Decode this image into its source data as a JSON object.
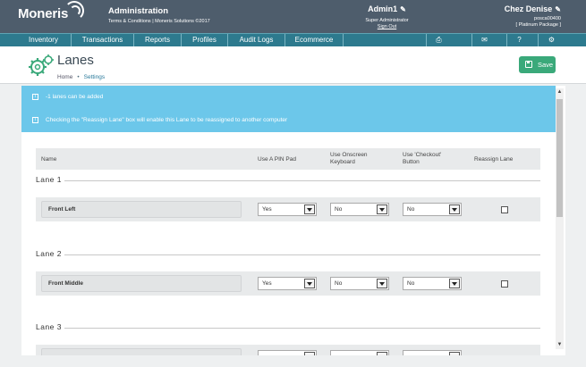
{
  "header": {
    "logo": "Moneris",
    "app_title": "Administration",
    "subtitle": "Terms & Conditions | Moneris Solutions ©2017",
    "user_name": "Admin1",
    "user_role": "Super Administrator",
    "sign_out": "Sign Out",
    "store_name": "Chez Denise",
    "store_id": "posca00400",
    "package": "[ Platinum Package ]"
  },
  "nav": {
    "items": [
      "Inventory",
      "Transactions",
      "Reports",
      "Profiles",
      "Audit Logs",
      "Ecommerce"
    ],
    "icons": [
      "printer-icon",
      "mail-icon",
      "help-icon",
      "settings-icon"
    ]
  },
  "page": {
    "title": "Lanes",
    "breadcrumb_home": "Home",
    "breadcrumb_sep": "•",
    "breadcrumb_current": "Settings",
    "save_label": "Save"
  },
  "banner": {
    "line1": "-1 lanes can be added",
    "line2": "Checking the \"Reassign Lane\" box will enable this Lane to be reassigned to another computer",
    "info_glyph": "i"
  },
  "table": {
    "col_name": "Name",
    "col_pinpad": "Use A PIN Pad",
    "col_onscreen": "Use Onscreen Keyboard",
    "col_checkout": "Use 'Checkout' Button",
    "col_reassign": "Reassign Lane"
  },
  "lanes": [
    {
      "title": "Lane 1",
      "name": "Front Left",
      "pinpad": "Yes",
      "onscreen": "No",
      "checkout": "No",
      "reassign": false
    },
    {
      "title": "Lane 2",
      "name": "Front Middle",
      "pinpad": "Yes",
      "onscreen": "No",
      "checkout": "No",
      "reassign": false
    },
    {
      "title": "Lane 3",
      "name": "",
      "pinpad": "",
      "onscreen": "",
      "checkout": "",
      "reassign": false
    }
  ],
  "colors": {
    "topbar": "#4e5d6c",
    "navbar": "#2d7a8e",
    "banner": "#6cc7ea",
    "save": "#3aa97a"
  }
}
